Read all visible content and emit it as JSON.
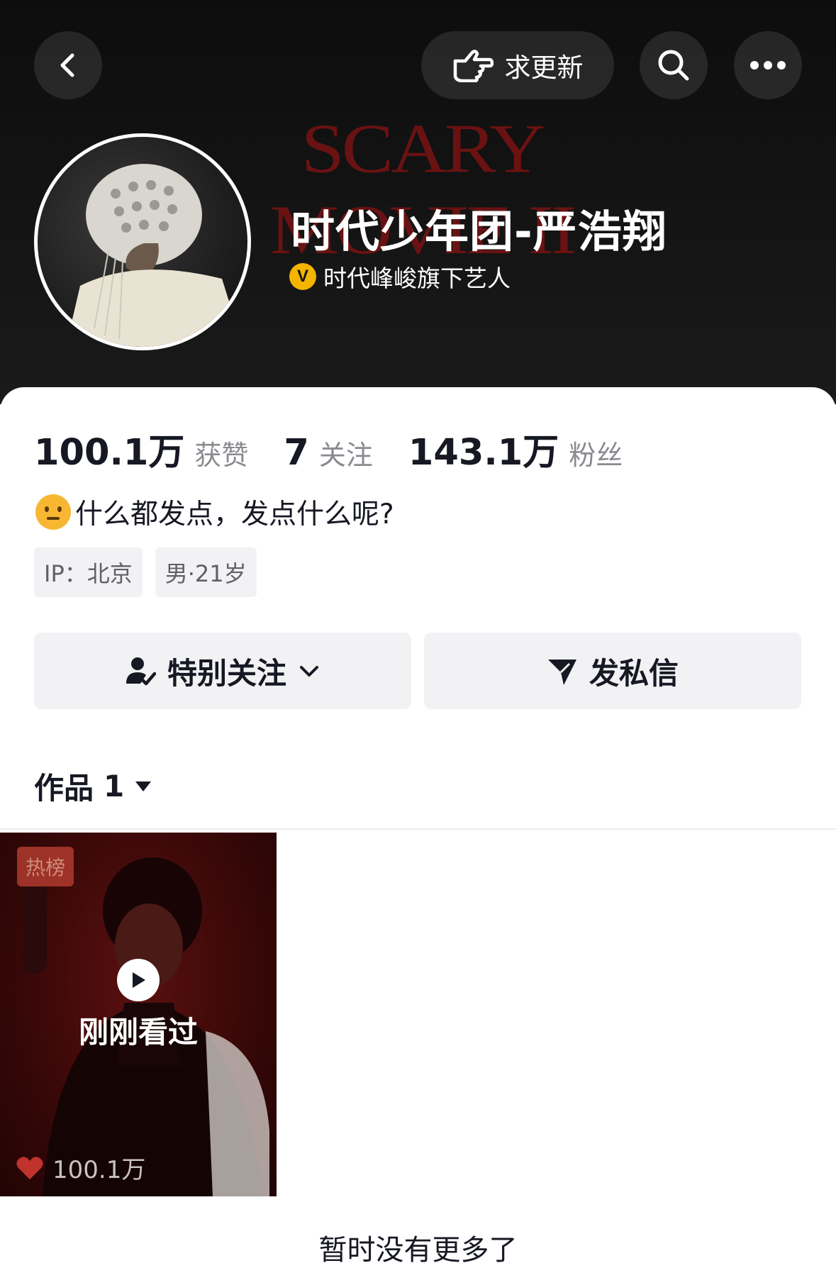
{
  "header": {
    "banner_text": "SCARY MOVIE II",
    "request_update_label": "求更新",
    "name": "时代少年团-严浩翔",
    "verify_badge": "V",
    "verify_text": "时代峰峻旗下艺人"
  },
  "stats": [
    {
      "value": "100.1万",
      "label": "获赞"
    },
    {
      "value": "7",
      "label": "关注"
    },
    {
      "value": "143.1万",
      "label": "粉丝"
    }
  ],
  "bio": "什么都发点，发点什么呢?",
  "tags": [
    "IP：北京",
    "男·21岁"
  ],
  "actions": {
    "follow_label": "特别关注",
    "message_label": "发私信"
  },
  "works": {
    "label": "作品",
    "count": "1"
  },
  "video": {
    "hot_badge": "热榜",
    "watched_label": "刚刚看过",
    "likes": "100.1万"
  },
  "footer_text": "暂时没有更多了",
  "colors": {
    "accent_gold": "#f5b400",
    "like_red": "#c0322b",
    "text_primary": "#161823",
    "text_secondary": "#8a8b91"
  }
}
